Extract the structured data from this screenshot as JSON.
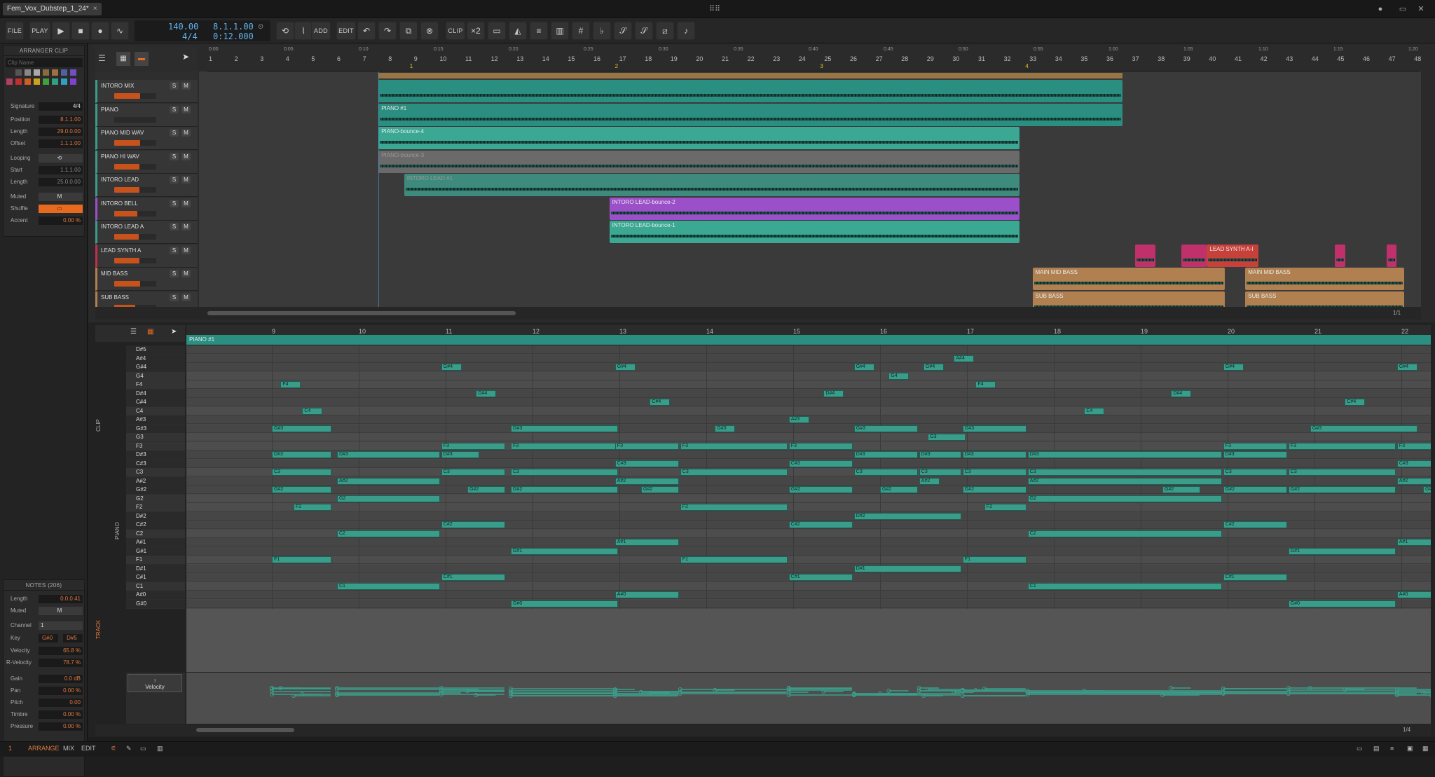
{
  "window": {
    "tab_title": "Fem_Vox_Dubstep_1_24*",
    "tab_close": "×",
    "center_icon": "⠿⠿"
  },
  "toolbar": {
    "file": "FILE",
    "play_label": "PLAY",
    "add": "ADD",
    "edit": "EDIT",
    "clip": "CLIP",
    "tempo": "140.00",
    "meter": "4/4",
    "position_bars": "8.1.1.00",
    "position_time": "0:12.000"
  },
  "arranger_clip": {
    "title": "ARRANGER CLIP",
    "clip_name_placeholder": "Clip Name",
    "signature_label": "Signature",
    "signature": "4/4",
    "position_label": "Position",
    "position": "8.1.1.00",
    "length_label": "Length",
    "length": "29.0.0.00",
    "offset_label": "Offset",
    "offset": "1.1.1.00",
    "looping_label": "Looping",
    "start_label": "Start",
    "start": "1.1.1.00",
    "loop_length_label": "Length",
    "loop_length": "25.0.0.00",
    "muted_label": "Muted",
    "muted": "M",
    "shuffle_label": "Shuffle",
    "accent_label": "Accent",
    "accent": "0.00 %",
    "swatches": [
      "#2a2a2a",
      "#555",
      "#888",
      "#aaa",
      "#8b6a3e",
      "#a07040",
      "#5060a0",
      "#7050c0",
      "#b04060",
      "#c03030",
      "#d06020",
      "#d0a020",
      "#40a040",
      "#30a080",
      "#30a0c0",
      "#8040d0"
    ]
  },
  "notes_panel": {
    "title": "NOTES (206)",
    "length_label": "Length",
    "length": "0.0.0.41",
    "muted_label": "Muted",
    "muted": "M",
    "channel_label": "Channel",
    "channel": "1",
    "key_label": "Key",
    "key_from": "G#0",
    "key_to": "D#5",
    "velocity_label": "Velocity",
    "velocity": "65.8 %",
    "velocity_level": 0.658,
    "rvelocity_label": "R-Velocity",
    "rvelocity": "78.7 %",
    "rvelocity_level": 0.787,
    "gain_label": "Gain",
    "gain": "0.0 dB",
    "pan_label": "Pan",
    "pan": "0.00 %",
    "pitch_label": "Pitch",
    "pitch": "0.00",
    "timbre_label": "Timbre",
    "timbre": "0.00 %",
    "pressure_label": "Pressure",
    "pressure": "0.00 %"
  },
  "ruler": {
    "bars": [
      "1",
      "2",
      "3",
      "4",
      "5",
      "6",
      "7",
      "8",
      "9",
      "10",
      "11",
      "12",
      "13",
      "14",
      "15",
      "16",
      "17",
      "18",
      "19",
      "20",
      "21",
      "22",
      "23",
      "24",
      "25",
      "26",
      "27",
      "28",
      "29",
      "30",
      "31",
      "32",
      "33",
      "34",
      "35",
      "36",
      "37",
      "38",
      "39",
      "40",
      "41",
      "42",
      "43",
      "44",
      "45",
      "46",
      "47",
      "48"
    ],
    "times": [
      "0:00",
      "0:05",
      "0:10",
      "0:15",
      "0:20",
      "0:25",
      "0:30",
      "0:35",
      "0:40",
      "0:45",
      "0:50",
      "0:55",
      "1:00",
      "1:05",
      "1:10",
      "1:15",
      "1:20"
    ],
    "markers": [
      "1",
      "2",
      "3",
      "4"
    ]
  },
  "tracks": [
    {
      "name": "INTORO MIX",
      "color": "#3a9d8a",
      "meter": 0.62
    },
    {
      "name": "PIANO",
      "color": "#3a9d8a",
      "meter": 0.0
    },
    {
      "name": "PIANO MID WAV",
      "color": "#3a9d8a",
      "meter": 0.62
    },
    {
      "name": "PIANO HI WAV",
      "color": "#3a9d8a",
      "meter": 0.6
    },
    {
      "name": "INTORO LEAD",
      "color": "#3a9d8a",
      "meter": 0.6
    },
    {
      "name": "INTORO BELL",
      "color": "#9b4fc9",
      "meter": 0.55
    },
    {
      "name": "INTORO LEAD A",
      "color": "#3a9d8a",
      "meter": 0.58
    },
    {
      "name": "LEAD SYNTH A",
      "color": "#c0304a",
      "meter": 0.6
    },
    {
      "name": "MID BASS",
      "color": "#b08050",
      "meter": 0.62
    },
    {
      "name": "SUB BASS",
      "color": "#b08050",
      "meter": 0.5
    }
  ],
  "track_buttons": {
    "s": "S",
    "m": "M"
  },
  "clips": {
    "piano1": "PIANO #1",
    "bounce4": "PIANO-bounce-4",
    "bounce3": "PIANO-bounce-3",
    "lead1": "INTORO LEAD #1",
    "lead_b2": "INTORO LEAD-bounce-2",
    "lead_b1": "INTORO LEAD-bounce-1",
    "lead_synth": "LEAD SYNTH A-I",
    "main_mid_bass": "MAIN MID BASS",
    "sub_bass": "SUB BASS"
  },
  "arranger_status": {
    "page": "1/1"
  },
  "pianoroll": {
    "clip_name": "PIANO #1",
    "bars": [
      "9",
      "10",
      "11",
      "12",
      "13",
      "14",
      "15",
      "16",
      "17",
      "18",
      "19",
      "20",
      "21",
      "22"
    ],
    "keys": [
      "D#5",
      "A#4",
      "G#4",
      "G4",
      "F4",
      "D#4",
      "C#4",
      "C4",
      "A#3",
      "G#3",
      "G3",
      "F3",
      "D#3",
      "C#3",
      "C3",
      "A#2",
      "G#2",
      "G2",
      "F2",
      "D#2",
      "C#2",
      "C2",
      "A#1",
      "G#1",
      "F1",
      "D#1",
      "C#1",
      "C1",
      "A#0",
      "G#0"
    ],
    "velocity_label": "Velocity",
    "clip_side_label": "CLIP",
    "piano_side_label": "PIANO",
    "track_side_label": "TRACK",
    "zoom": "1/4",
    "notes": [
      [
        "F4",
        0.1,
        0.35
      ],
      [
        "G#4",
        1.95,
        2.2
      ],
      [
        "G#4",
        3.95,
        4.2
      ],
      [
        "G#4",
        6.7,
        6.95
      ],
      [
        "G4",
        7.1,
        7.35
      ],
      [
        "G#4",
        7.5,
        7.75
      ],
      [
        "A#4",
        7.85,
        8.1
      ],
      [
        "G#4",
        10.95,
        11.2
      ],
      [
        "G#4",
        12.95,
        13.2
      ],
      [
        "F4",
        8.1,
        8.35
      ],
      [
        "D#4",
        2.35,
        2.6
      ],
      [
        "D#4",
        6.35,
        6.6
      ],
      [
        "D#4",
        10.35,
        10.6
      ],
      [
        "C#4",
        4.35,
        4.6
      ],
      [
        "C#4",
        12.35,
        12.6
      ],
      [
        "C4",
        0.35,
        0.6
      ],
      [
        "C4",
        9.35,
        9.6
      ],
      [
        "C4",
        13.35,
        13.6
      ],
      [
        "A#3",
        5.95,
        6.2
      ],
      [
        "G#3",
        0.0,
        0.7
      ],
      [
        "G#3",
        2.75,
        4.0
      ],
      [
        "G#3",
        5.1,
        5.35
      ],
      [
        "G#3",
        6.7,
        7.45
      ],
      [
        "G#3",
        7.95,
        8.7
      ],
      [
        "G#3",
        11.95,
        13.2
      ],
      [
        "G#3",
        13.95,
        14.4
      ],
      [
        "G3",
        7.55,
        8.0
      ],
      [
        "F3",
        1.95,
        2.7
      ],
      [
        "F3",
        2.75,
        4.0
      ],
      [
        "F3",
        3.95,
        4.7
      ],
      [
        "F3",
        4.7,
        5.95
      ],
      [
        "F3",
        5.95,
        6.7
      ],
      [
        "F3",
        10.95,
        11.7
      ],
      [
        "F3",
        11.7,
        12.95
      ],
      [
        "F3",
        12.95,
        13.7
      ],
      [
        "F3",
        13.7,
        14.4
      ],
      [
        "D#3",
        0.0,
        0.7
      ],
      [
        "D#3",
        0.75,
        1.95
      ],
      [
        "D#3",
        1.95,
        2.4
      ],
      [
        "D#3",
        6.7,
        7.45
      ],
      [
        "D#3",
        7.45,
        7.95
      ],
      [
        "D#3",
        7.95,
        8.7
      ],
      [
        "D#3",
        8.7,
        10.95
      ],
      [
        "D#3",
        10.95,
        11.7
      ],
      [
        "C#3",
        3.95,
        4.7
      ],
      [
        "C#3",
        5.95,
        6.7
      ],
      [
        "C#3",
        12.95,
        13.7
      ],
      [
        "C3",
        0.0,
        0.7
      ],
      [
        "C3",
        1.95,
        2.7
      ],
      [
        "C3",
        2.75,
        4.0
      ],
      [
        "C3",
        4.7,
        5.95
      ],
      [
        "C3",
        6.7,
        7.45
      ],
      [
        "C3",
        7.45,
        7.95
      ],
      [
        "C3",
        7.95,
        8.7
      ],
      [
        "C3",
        8.7,
        10.95
      ],
      [
        "C3",
        10.95,
        11.7
      ],
      [
        "C3",
        11.7,
        12.95
      ],
      [
        "C3",
        13.7,
        14.4
      ],
      [
        "A#2",
        0.75,
        1.95
      ],
      [
        "A#2",
        3.95,
        4.7
      ],
      [
        "A#2",
        7.45,
        7.7
      ],
      [
        "A#2",
        8.7,
        10.95
      ],
      [
        "A#2",
        12.95,
        13.7
      ],
      [
        "G#2",
        0.0,
        0.7
      ],
      [
        "G#2",
        2.25,
        2.7
      ],
      [
        "G#2",
        2.75,
        4.0
      ],
      [
        "G#2",
        4.25,
        4.7
      ],
      [
        "G#2",
        5.95,
        6.7
      ],
      [
        "G#2",
        7.0,
        7.45
      ],
      [
        "G#2",
        7.95,
        8.7
      ],
      [
        "G#2",
        10.25,
        10.7
      ],
      [
        "G#2",
        10.95,
        11.7
      ],
      [
        "G#2",
        11.7,
        12.95
      ],
      [
        "G#2",
        13.25,
        13.7
      ],
      [
        "G#2",
        13.7,
        14.4
      ],
      [
        "G2",
        0.75,
        1.95
      ],
      [
        "G2",
        8.7,
        10.95
      ],
      [
        "F2",
        0.25,
        0.7
      ],
      [
        "F2",
        4.7,
        5.95
      ],
      [
        "F2",
        8.2,
        8.7
      ],
      [
        "D#2",
        6.7,
        7.95
      ],
      [
        "C#2",
        1.95,
        2.7
      ],
      [
        "C#2",
        5.95,
        6.7
      ],
      [
        "C#2",
        10.95,
        11.7
      ],
      [
        "C2",
        0.75,
        1.95
      ],
      [
        "C2",
        8.7,
        10.95
      ],
      [
        "C2",
        14.0,
        14.4
      ],
      [
        "A#1",
        3.95,
        4.7
      ],
      [
        "A#1",
        12.95,
        13.7
      ],
      [
        "G#1",
        2.75,
        4.0
      ],
      [
        "G#1",
        11.7,
        12.95
      ],
      [
        "F1",
        0.0,
        0.7
      ],
      [
        "F1",
        4.7,
        5.95
      ],
      [
        "F1",
        7.95,
        8.7
      ],
      [
        "D#1",
        6.7,
        7.95
      ],
      [
        "C#1",
        1.95,
        2.7
      ],
      [
        "C#1",
        5.95,
        6.7
      ],
      [
        "C#1",
        10.95,
        11.7
      ],
      [
        "C1",
        0.75,
        1.95
      ],
      [
        "C1",
        8.7,
        10.95
      ],
      [
        "C1",
        13.7,
        14.4
      ],
      [
        "A#0",
        3.95,
        4.7
      ],
      [
        "A#0",
        12.95,
        13.7
      ],
      [
        "G#0",
        2.75,
        4.0
      ],
      [
        "G#0",
        11.7,
        12.95
      ]
    ]
  },
  "bottom": {
    "arrange": "ARRANGE",
    "mix": "MIX",
    "edit": "EDIT",
    "num": "1"
  }
}
